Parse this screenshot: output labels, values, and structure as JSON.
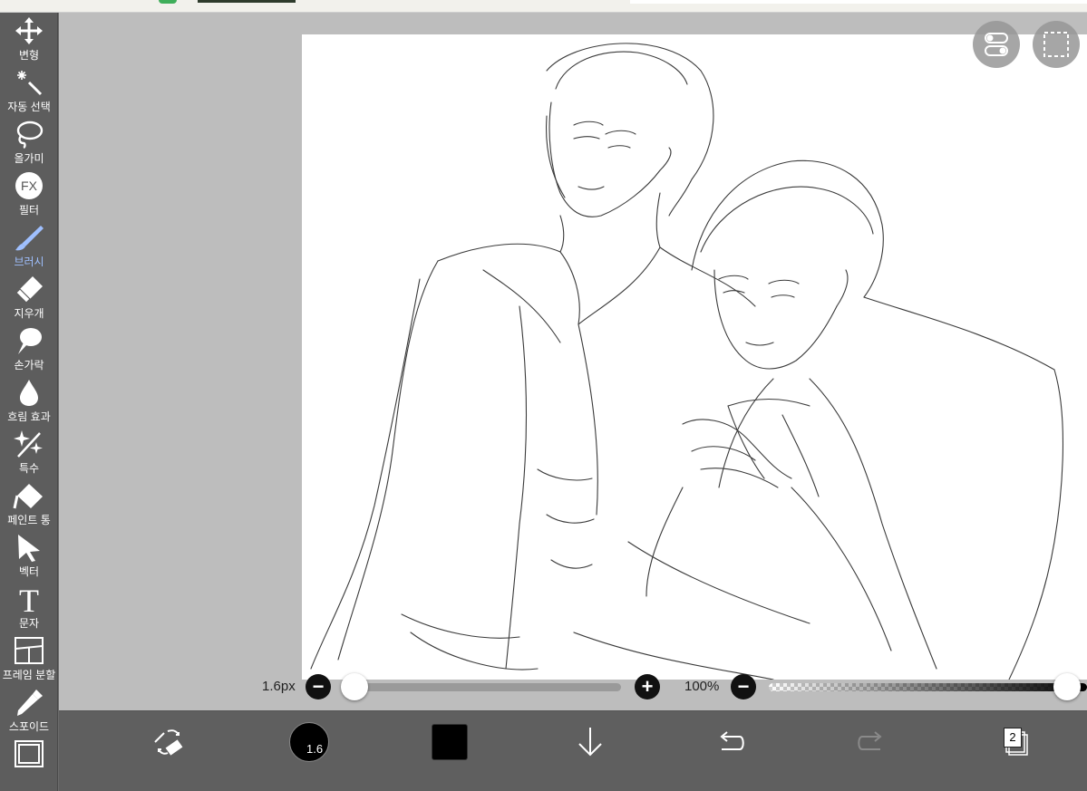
{
  "toolbar": {
    "items": [
      {
        "label": "변형",
        "icon": "move-icon"
      },
      {
        "label": "자동 선택",
        "icon": "magic-wand-icon"
      },
      {
        "label": "올가미",
        "icon": "lasso-icon"
      },
      {
        "label": "필터",
        "icon": "fx-icon",
        "glyph": "FX"
      },
      {
        "label": "브러시",
        "icon": "brush-icon",
        "active": true
      },
      {
        "label": "지우개",
        "icon": "eraser-icon"
      },
      {
        "label": "손가락",
        "icon": "smudge-icon"
      },
      {
        "label": "흐림 효과",
        "icon": "blur-drop-icon"
      },
      {
        "label": "특수",
        "icon": "sparkle-icon"
      },
      {
        "label": "페인트 통",
        "icon": "paint-bucket-icon"
      },
      {
        "label": "벡터",
        "icon": "vector-cursor-icon"
      },
      {
        "label": "문자",
        "icon": "text-icon",
        "glyph": "T"
      },
      {
        "label": "프레임 분할",
        "icon": "frame-split-icon"
      },
      {
        "label": "스포이드",
        "icon": "eyedropper-icon"
      },
      {
        "label": "",
        "icon": "canvas-icon"
      }
    ],
    "active_color": "#9fc0ff"
  },
  "brush_size": {
    "value_label": "1.6px",
    "minus": "−",
    "plus": "+"
  },
  "opacity": {
    "value_label": "100%",
    "minus": "−"
  },
  "bottom": {
    "brush_size_indicator": "1.6",
    "color": "#000000",
    "layer_count": "2"
  },
  "colors": {
    "toolbar_bg": "#5d5d5d",
    "workspace_bg": "#bdbdbd",
    "canvas_bg": "#ffffff",
    "bottom_bg": "#5f5f5f"
  }
}
